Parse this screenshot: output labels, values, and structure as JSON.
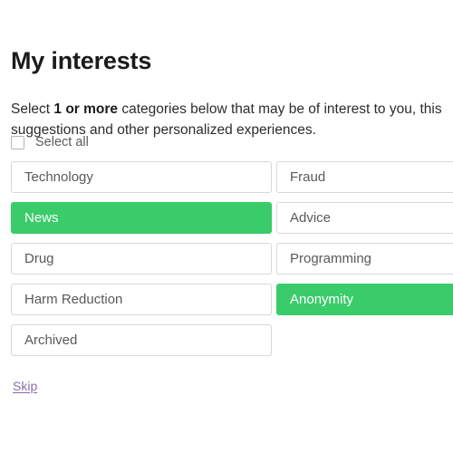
{
  "page": {
    "title": "My interests",
    "intro_prefix": "Select ",
    "intro_strong": "1 or more",
    "intro_suffix": " categories below that may be of interest to you, this\nsuggestions and other personalized experiences.",
    "select_all_label": "Select all",
    "skip_label": "Skip"
  },
  "colors": {
    "selected_green": "#3acc6b",
    "chip_border": "#d7d7d7",
    "chip_text": "#58595b",
    "selected_text": "#ffffff",
    "link_purple": "#8a6ca8",
    "background": "#ffffff"
  },
  "categories": {
    "left_column": [
      {
        "label": "Technology",
        "selected": false
      },
      {
        "label": "News",
        "selected": true
      },
      {
        "label": "Drug",
        "selected": false
      },
      {
        "label": "Harm Reduction",
        "selected": false
      },
      {
        "label": "Archived",
        "selected": false
      }
    ],
    "right_column": [
      {
        "label": "Fraud",
        "selected": false
      },
      {
        "label": "Advice",
        "selected": false
      },
      {
        "label": "Programming",
        "selected": false
      },
      {
        "label": "Anonymity",
        "selected": true
      }
    ]
  }
}
